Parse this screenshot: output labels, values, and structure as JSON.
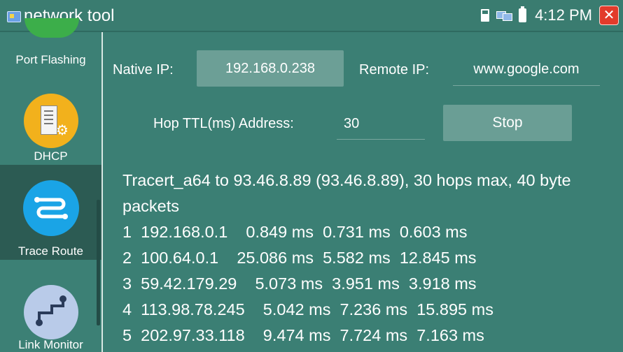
{
  "app": {
    "title": "network tool"
  },
  "status": {
    "time": "4:12 PM"
  },
  "sidebar": {
    "items": [
      {
        "label": "Port Flashing"
      },
      {
        "label": "DHCP"
      },
      {
        "label": "Trace Route"
      },
      {
        "label": "Link Monitor"
      }
    ],
    "active": "Trace Route"
  },
  "form": {
    "native_ip_label": "Native IP:",
    "native_ip_value": "192.168.0.238",
    "remote_ip_label": "Remote IP:",
    "remote_ip_value": "www.google.com",
    "hop_label": "Hop TTL(ms) Address:",
    "hop_value": "30",
    "stop_label": "Stop"
  },
  "output": {
    "header": "Tracert_a64 to 93.46.8.89 (93.46.8.89), 30 hops max, 40 byte packets",
    "hops": [
      "1  192.168.0.1    0.849 ms  0.731 ms  0.603 ms",
      "2  100.64.0.1    25.086 ms  5.582 ms  12.845 ms",
      "3  59.42.179.29    5.073 ms  3.951 ms  3.918 ms",
      "4  113.98.78.245    5.042 ms  7.236 ms  15.895 ms",
      "5  202.97.33.118    9.474 ms  7.724 ms  7.163 ms"
    ]
  },
  "colors": {
    "background": "#3b7f74",
    "sidebar_active": "#2c5b53",
    "button": "#6a9e95",
    "close": "#e23b2b",
    "trace_icon": "#1aa4e6",
    "dhcp_icon": "#f2b11c",
    "monitor_icon": "#b9cbe9",
    "port_icon": "#3cae4a"
  },
  "icons": [
    "app-icon",
    "sd-card-icon",
    "network-icon",
    "battery-icon",
    "close-icon",
    "port-flashing-icon",
    "dhcp-server-icon",
    "trace-route-icon",
    "link-monitor-icon"
  ]
}
